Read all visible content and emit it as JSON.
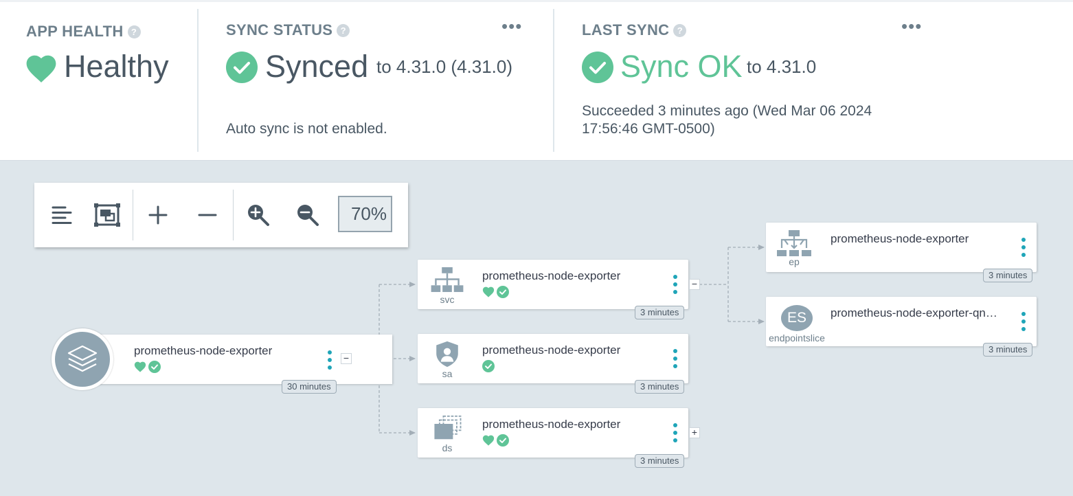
{
  "colors": {
    "healthy": "#5fc497",
    "accent": "#1fa5b8",
    "node_gray": "#8fa4b1"
  },
  "app_health": {
    "title": "APP HEALTH",
    "help": "?",
    "status": "Healthy",
    "icon": "heart-icon"
  },
  "sync_status": {
    "title": "SYNC STATUS",
    "help": "?",
    "menu": "•••",
    "status": "Synced",
    "target": "to 4.31.0 (4.31.0)",
    "note": "Auto sync is not enabled.",
    "icon": "check-circle-icon"
  },
  "last_sync": {
    "title": "LAST SYNC",
    "help": "?",
    "menu": "•••",
    "status": "Sync OK",
    "target": "to 4.31.0",
    "detail_line1": "Succeeded 3 minutes ago (Wed Mar 06 2024",
    "detail_line2": "17:56:46 GMT-0500)",
    "icon": "check-circle-icon"
  },
  "toolbar": {
    "zoom": "70%",
    "buttons": [
      "list-view-icon",
      "fit-screen-icon",
      "expand-icon",
      "collapse-icon",
      "zoom-in-icon",
      "zoom-out-icon"
    ]
  },
  "graph": {
    "app": {
      "name": "prometheus-node-exporter",
      "age": "30 minutes",
      "collapse": "−"
    },
    "svc": {
      "name": "prometheus-node-exporter",
      "kind": "svc",
      "age": "3 minutes",
      "collapse": "−"
    },
    "sa": {
      "name": "prometheus-node-exporter",
      "kind": "sa",
      "age": "3 minutes"
    },
    "ds": {
      "name": "prometheus-node-exporter",
      "kind": "ds",
      "age": "3 minutes",
      "expand": "+"
    },
    "ep": {
      "name": "prometheus-node-exporter",
      "kind": "ep",
      "age": "3 minutes"
    },
    "es": {
      "name": "prometheus-node-exporter-qn…",
      "kind": "endpointslice",
      "badge": "ES",
      "age": "3 minutes"
    }
  }
}
